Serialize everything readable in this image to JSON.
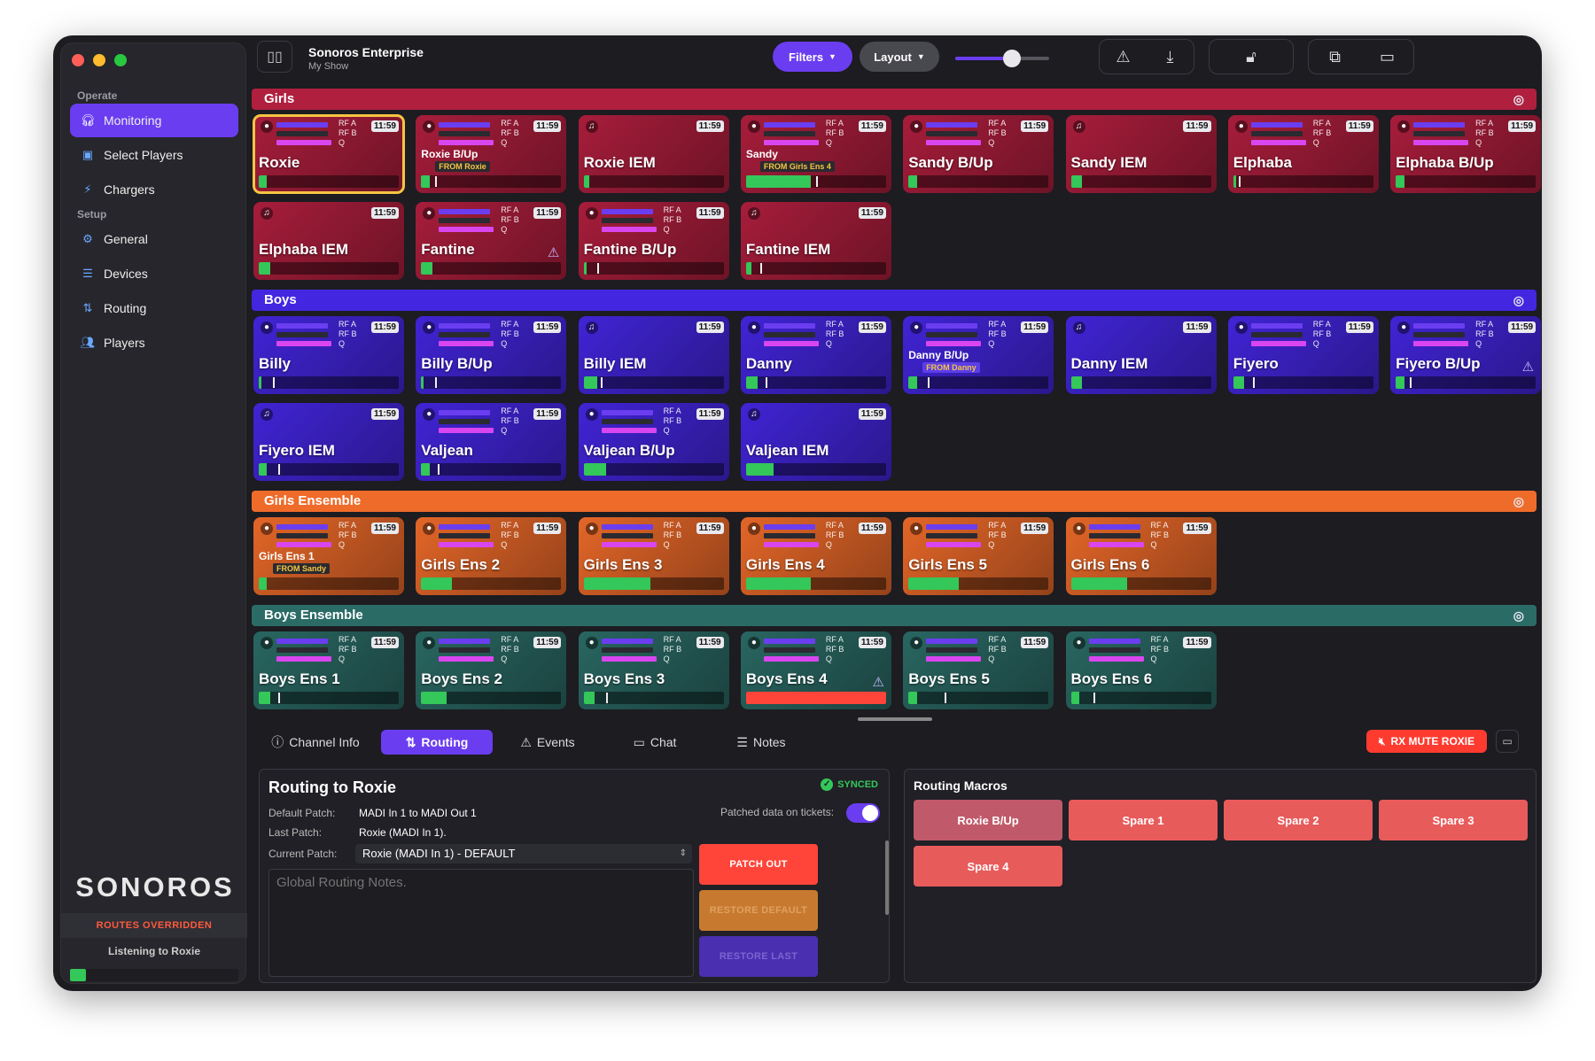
{
  "app": {
    "title": "Sonoros Enterprise",
    "subtitle": "My Show"
  },
  "toolbar": {
    "filters": "Filters",
    "layout": "Layout",
    "volume": 0.6
  },
  "sidebar": {
    "sections": [
      {
        "header": "Operate",
        "items": [
          "Monitoring",
          "Select Players",
          "Chargers"
        ]
      },
      {
        "header": "Setup",
        "items": [
          "General",
          "Devices",
          "Routing",
          "Players"
        ]
      }
    ],
    "logo": "SONOROS",
    "routes_overridden": "ROUTES OVERRIDDEN",
    "listening": "Listening to Roxie"
  },
  "groups": [
    {
      "name": "Girls",
      "color": "#b01f3e",
      "cards": [
        {
          "name": "Roxie",
          "type": "mic",
          "selected": true,
          "bar": 0.06,
          "peak": 0.06
        },
        {
          "name": "Roxie B/Up",
          "type": "mic",
          "from": "FROM Roxie",
          "bar": 0.06,
          "peak": 0.1
        },
        {
          "name": "Roxie IEM",
          "type": "iem",
          "bar": 0.04,
          "peak": 0.04
        },
        {
          "name": "Sandy",
          "type": "mic",
          "from": "FROM Girls Ens 4",
          "bar": 0.46,
          "peak": 0.5
        },
        {
          "name": "Sandy B/Up",
          "type": "mic",
          "bar": 0.06,
          "peak": 0.06
        },
        {
          "name": "Sandy IEM",
          "type": "iem",
          "bar": 0.08,
          "peak": 0.08
        },
        {
          "name": "Elphaba",
          "type": "mic",
          "bar": 0.02,
          "peak": 0.04
        },
        {
          "name": "Elphaba B/Up",
          "type": "mic",
          "bar": 0.06,
          "peak": 0.06
        },
        {
          "name": "Elphaba IEM",
          "type": "iem",
          "bar": 0.08,
          "peak": 0.08
        },
        {
          "name": "Fantine",
          "type": "mic",
          "warn": true,
          "bar": 0.08,
          "peak": 0.08
        },
        {
          "name": "Fantine B/Up",
          "type": "mic",
          "bar": 0.02,
          "peak": 0.1
        },
        {
          "name": "Fantine IEM",
          "type": "iem",
          "bar": 0.04,
          "peak": 0.1
        }
      ]
    },
    {
      "name": "Boys",
      "color": "#4326e0",
      "cards": [
        {
          "name": "Billy",
          "type": "mic",
          "bar": 0.02,
          "peak": 0.1
        },
        {
          "name": "Billy B/Up",
          "type": "mic",
          "bar": 0.02,
          "peak": 0.1
        },
        {
          "name": "Billy IEM",
          "type": "iem",
          "bar": 0.1,
          "peak": 0.12
        },
        {
          "name": "Danny",
          "type": "mic",
          "bar": 0.08,
          "peak": 0.14
        },
        {
          "name": "Danny B/Up",
          "type": "mic",
          "from": "FROM Danny",
          "bar": 0.06,
          "peak": 0.14
        },
        {
          "name": "Danny IEM",
          "type": "iem",
          "bar": 0.08,
          "peak": 0.08
        },
        {
          "name": "Fiyero",
          "type": "mic",
          "bar": 0.08,
          "peak": 0.14
        },
        {
          "name": "Fiyero B/Up",
          "type": "mic",
          "warn": true,
          "bar": 0.06,
          "peak": 0.1
        },
        {
          "name": "Fiyero IEM",
          "type": "iem",
          "bar": 0.06,
          "peak": 0.14
        },
        {
          "name": "Valjean",
          "type": "mic",
          "bar": 0.06,
          "peak": 0.12
        },
        {
          "name": "Valjean B/Up",
          "type": "mic",
          "bar": 0.16,
          "peak": 0.16
        },
        {
          "name": "Valjean IEM",
          "type": "iem",
          "bar": 0.2,
          "peak": 0.2
        }
      ]
    },
    {
      "name": "Girls Ensemble",
      "color": "#ef6b2a",
      "cards": [
        {
          "name": "Girls Ens 1",
          "type": "mic",
          "from": "FROM Sandy",
          "bar": 0.06,
          "peak": 0.06
        },
        {
          "name": "Girls Ens 2",
          "type": "mic",
          "bar": 0.22,
          "peak": 0.22
        },
        {
          "name": "Girls Ens 3",
          "type": "mic",
          "bar": 0.48,
          "peak": 0.48
        },
        {
          "name": "Girls Ens 4",
          "type": "mic",
          "bar": 0.46,
          "peak": 0.46
        },
        {
          "name": "Girls Ens 5",
          "type": "mic",
          "bar": 0.36,
          "peak": 0.36
        },
        {
          "name": "Girls Ens 6",
          "type": "mic",
          "bar": 0.4,
          "peak": 0.4
        }
      ]
    },
    {
      "name": "Boys Ensemble",
      "color": "#2b6b66",
      "cards": [
        {
          "name": "Boys Ens 1",
          "type": "mic",
          "bar": 0.08,
          "peak": 0.14
        },
        {
          "name": "Boys Ens 2",
          "type": "mic",
          "bar": 0.18,
          "peak": 0.18
        },
        {
          "name": "Boys Ens 3",
          "type": "mic",
          "bar": 0.08,
          "peak": 0.16
        },
        {
          "name": "Boys Ens 4",
          "type": "mic",
          "warn": true,
          "bar": 1.0,
          "peak": 1.0,
          "red": true
        },
        {
          "name": "Boys Ens 5",
          "type": "mic",
          "bar": 0.06,
          "peak": 0.26
        },
        {
          "name": "Boys Ens 6",
          "type": "mic",
          "bar": 0.06,
          "peak": 0.16
        }
      ]
    }
  ],
  "card_labels": {
    "rfa": "RF A",
    "rfb": "RF B",
    "q": "Q",
    "clock": "11:59"
  },
  "tabs": [
    "Channel Info",
    "Routing",
    "Events",
    "Chat",
    "Notes"
  ],
  "rx_mute": "RX MUTE ROXIE",
  "routing": {
    "title": "Routing to Roxie",
    "synced": "SYNCED",
    "default_patch_label": "Default Patch:",
    "default_patch": "MADI In 1 to MADI Out 1",
    "last_patch_label": "Last Patch:",
    "last_patch": "Roxie (MADI In 1).",
    "current_patch_label": "Current Patch:",
    "current_patch": "Roxie (MADI In 1) - DEFAULT",
    "patched_label": "Patched data on tickets:",
    "notes_placeholder": "Global Routing Notes.",
    "patch_out": "PATCH OUT",
    "restore_default": "RESTORE DEFAULT",
    "restore_last": "RESTORE LAST"
  },
  "macros": {
    "title": "Routing Macros",
    "items": [
      "Roxie B/Up",
      "Spare 1",
      "Spare 2",
      "Spare 3",
      "Spare 4"
    ]
  }
}
